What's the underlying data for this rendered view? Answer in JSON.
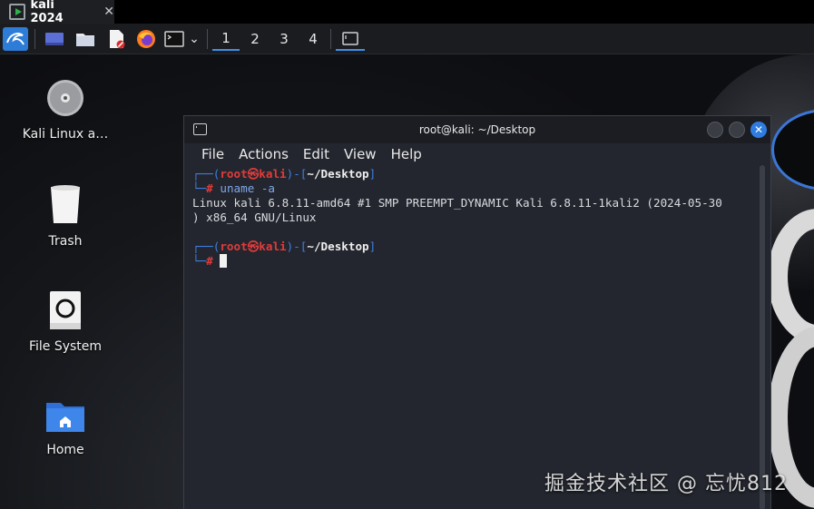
{
  "host_tab": {
    "title": "kali 2024",
    "close": "✕"
  },
  "panel": {
    "apps": [
      "kali-menu-icon",
      "show-desktop-icon",
      "file-manager-icon",
      "text-editor-icon",
      "firefox-icon",
      "terminal-icon"
    ],
    "dropdown": "⌄",
    "workspaces": [
      "1",
      "2",
      "3",
      "4"
    ],
    "active_workspace": "1"
  },
  "desktop": {
    "icons": [
      {
        "label": "Kali Linux a…",
        "icon": "disc-icon"
      },
      {
        "label": "Trash",
        "icon": "trash-icon"
      },
      {
        "label": "File System",
        "icon": "drive-icon"
      },
      {
        "label": "Home",
        "icon": "home-folder-icon"
      }
    ]
  },
  "terminal": {
    "title": "root@kali: ~/Desktop",
    "menu": [
      "File",
      "Actions",
      "Edit",
      "View",
      "Help"
    ],
    "lines": {
      "p1_user": "root",
      "p1_at": "㉿",
      "p1_host": "kali",
      "p1_path": "~/Desktop",
      "p1_cmd": "uname -a",
      "output1": "Linux kali 6.8.11-amd64 #1 SMP PREEMPT_DYNAMIC Kali 6.8.11-1kali2 (2024-05-30",
      "output2": ") x86_64 GNU/Linux",
      "p2_user": "root",
      "p2_at": "㉿",
      "p2_host": "kali",
      "p2_path": "~/Desktop"
    },
    "colors": {
      "background": "#23262e",
      "prompt_blue": "#3e7fe0",
      "prompt_red": "#e23b3b"
    }
  },
  "watermark": "掘金技术社区 @ 忘忧812"
}
